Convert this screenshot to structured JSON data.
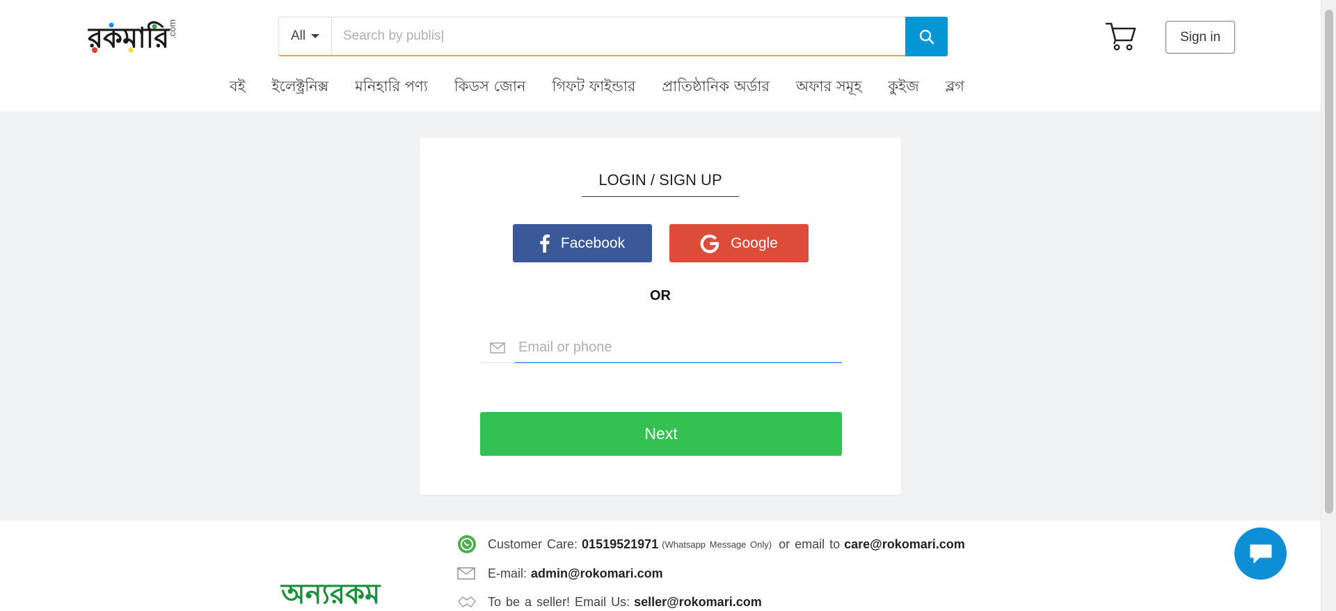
{
  "header": {
    "logo": {
      "text": "রকমারি",
      "suffix": ".com",
      "icon": "rokomari-logo"
    },
    "search": {
      "category": "All",
      "placeholder": "Search by publis|",
      "button_icon": "search-icon"
    },
    "cart_icon": "shopping-cart-icon",
    "signin_label": "Sign in",
    "nav": [
      "বই",
      "ইলেক্ট্রনিক্স",
      "মনিহারি পণ্য",
      "কিডস জোন",
      "গিফট ফাইন্ডার",
      "প্রাতিষ্ঠানিক অর্ডার",
      "অফার সমূহ",
      "কুইজ",
      "ব্লগ"
    ]
  },
  "login": {
    "title": "LOGIN / SIGN UP",
    "facebook_label": "Facebook",
    "google_label": "Google",
    "or_label": "OR",
    "email_placeholder": "Email or phone",
    "next_label": "Next"
  },
  "footer": {
    "brand_text": "অন্যরকম",
    "care_label": "Customer  Care:",
    "care_phone": "01519521971",
    "care_note": "(Whatsapp Message Only)",
    "care_or": "or  email  to",
    "care_email": "care@rokomari.com",
    "email_label": "E-mail:",
    "email_value": "admin@rokomari.com",
    "seller_label": "To  be  a  seller!  Email  Us:",
    "seller_value": "seller@rokomari.com"
  },
  "colors": {
    "search_accent": "#f5a623",
    "search_button": "#0397d6",
    "facebook": "#3b5998",
    "google": "#dd4b39",
    "next": "#33c153",
    "chat": "#0d8fd6"
  }
}
